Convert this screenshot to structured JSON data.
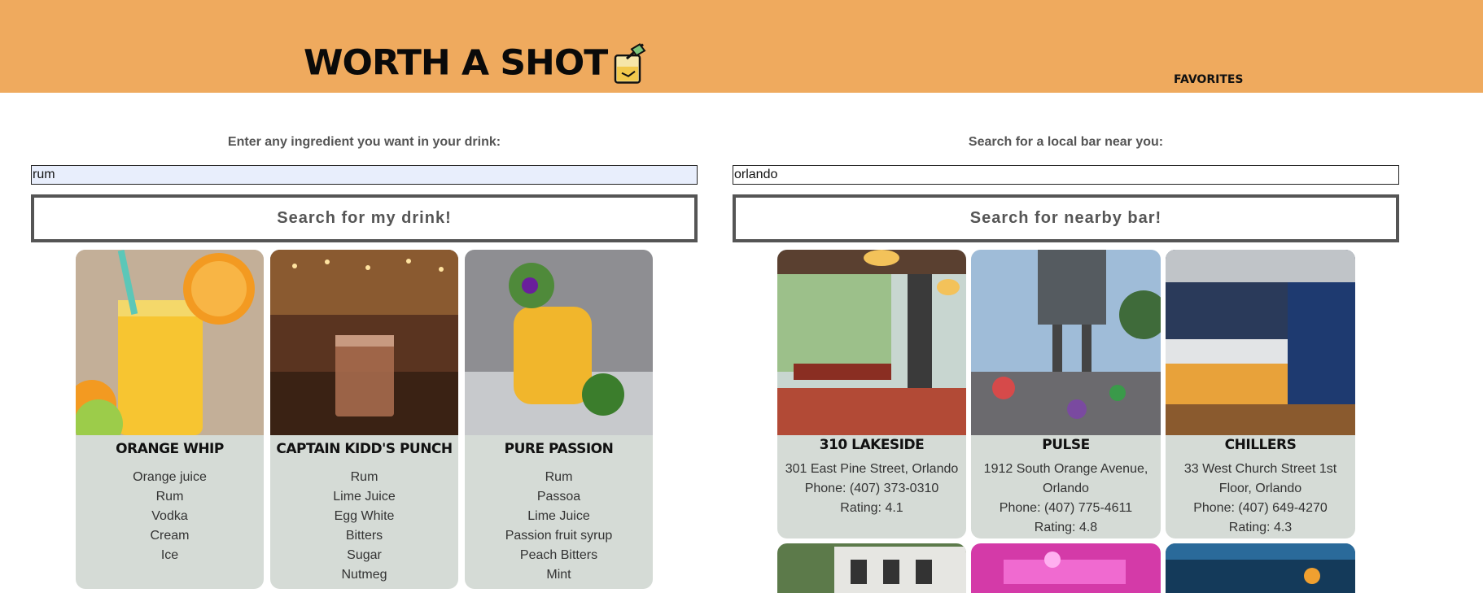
{
  "header": {
    "logo_text": "WORTH A SHOT",
    "favorites_label": "FAVORITES"
  },
  "drink_search": {
    "label": "Enter any ingredient you want in your drink:",
    "input_value": "rum",
    "button_label": "Search for my drink!"
  },
  "bar_search": {
    "label": "Search for a local bar near you:",
    "input_value": "orlando",
    "button_label": "Search for nearby bar!"
  },
  "drinks": [
    {
      "name": "Orange Whip",
      "ingredients": [
        "Orange juice",
        "Rum",
        "Vodka",
        "Cream",
        "Ice"
      ]
    },
    {
      "name": "Captain Kidd's Punch",
      "ingredients": [
        "Rum",
        "Lime Juice",
        "Egg White",
        "Bitters",
        "Sugar",
        "Nutmeg"
      ]
    },
    {
      "name": "Pure Passion",
      "ingredients": [
        "Rum",
        "Passoa",
        "Lime Juice",
        "Passion fruit syrup",
        "Peach Bitters",
        "Mint"
      ]
    }
  ],
  "bars": [
    {
      "name": "310 Lakeside",
      "address": "301 East Pine Street, Orlando",
      "phone": "Phone: (407) 373-0310",
      "rating": "Rating: 4.1"
    },
    {
      "name": "Pulse",
      "address": "1912 South Orange Avenue, Orlando",
      "phone": "Phone: (407) 775-4611",
      "rating": "Rating: 4.8"
    },
    {
      "name": "Chillers",
      "address": "33 West Church Street 1st Floor, Orlando",
      "phone": "Phone: (407) 649-4270",
      "rating": "Rating: 4.3"
    }
  ],
  "colors": {
    "header_bg": "#efaa5e",
    "card_bg": "#d5dbd6",
    "input_highlight": "#e8eefc"
  }
}
